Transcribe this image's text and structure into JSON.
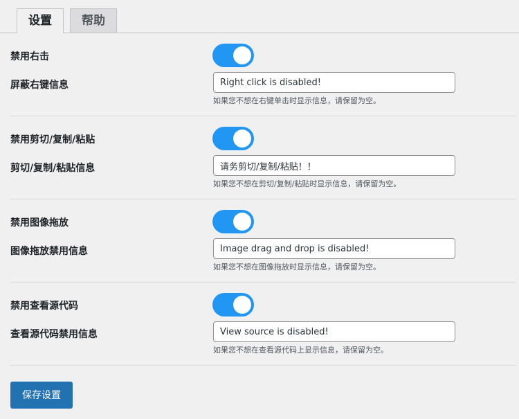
{
  "tabs": [
    {
      "label": "设置",
      "active": true
    },
    {
      "label": "帮助",
      "active": false
    }
  ],
  "sections": [
    {
      "toggle_label": "禁用右击",
      "toggle_on": true,
      "message_label": "屏蔽右键信息",
      "message_value": "Right click is disabled!",
      "hint": "如果您不想在右键单击时显示信息，请保留为空。"
    },
    {
      "toggle_label": "禁用剪切/复制/粘贴",
      "toggle_on": true,
      "message_label": "剪切/复制/粘贴信息",
      "message_value": "请务剪切/复制/粘贴！！",
      "hint": "如果您不想在剪切/复制/粘贴时显示信息，请保留为空。"
    },
    {
      "toggle_label": "禁用图像拖放",
      "toggle_on": true,
      "message_label": "图像拖放禁用信息",
      "message_value": "Image drag and drop is disabled!",
      "hint": "如果您不想在图像拖放时显示信息，请保留为空。"
    },
    {
      "toggle_label": "禁用查看源代码",
      "toggle_on": true,
      "message_label": "查看源代码禁用信息",
      "message_value": "View source is disabled!",
      "hint": "如果您不想在查看源代码上显示信息，请保留为空。"
    }
  ],
  "save_button": {
    "label": "保存设置"
  },
  "colors": {
    "toggle_on": "#2196f3",
    "primary_button": "#2271b1",
    "background": "#f0f0f1"
  }
}
